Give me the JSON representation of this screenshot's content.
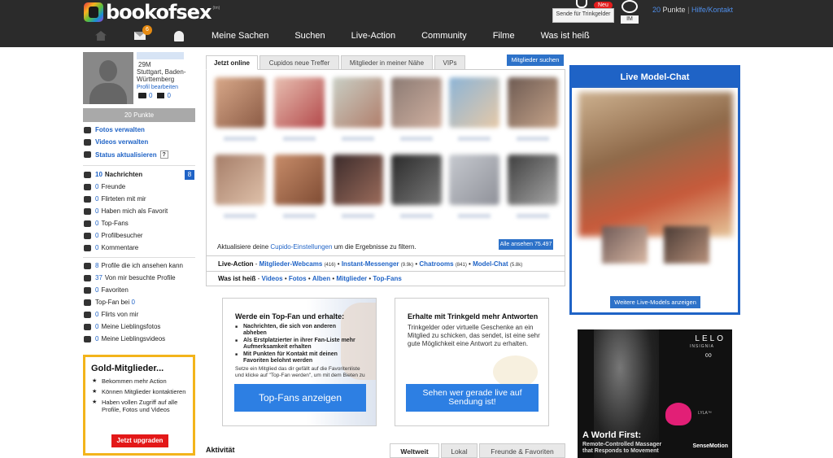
{
  "header": {
    "logo_text": "bookofsex",
    "logo_suffix": "(tm)",
    "tip_button": "Sende für Trinkgelder",
    "new_badge": "Neu",
    "im_label": "IM",
    "points_value": "20",
    "points_label": "Punkte",
    "separator": "|",
    "help_link": "Hilfe/Kontakt",
    "mail_count": "6",
    "nav": [
      "Meine Sachen",
      "Suchen",
      "Live-Action",
      "Community",
      "Filme",
      "Was ist heiß"
    ]
  },
  "profile": {
    "age_gender": "29M",
    "location": "Stuttgart, Baden-Württemberg",
    "edit_link": "Profil bearbeiten",
    "photo_count": "0",
    "video_count": "0",
    "points_bar": "20 Punkte"
  },
  "sidebar": {
    "manage": [
      "Fotos verwalten",
      "Videos verwalten",
      "Status aktualisieren"
    ],
    "help_mark": "?",
    "messages_count": "10",
    "messages_label": "Nachrichten",
    "messages_badge": "8",
    "stats": [
      {
        "num": "0",
        "label": "Freunde"
      },
      {
        "num": "0",
        "label": "Flirteten mit mir"
      },
      {
        "num": "0",
        "label": "Haben mich als Favorit"
      },
      {
        "num": "0",
        "label": "Top-Fans"
      },
      {
        "num": "0",
        "label": "Profilbesucher"
      },
      {
        "num": "0",
        "label": "Kommentare"
      }
    ],
    "stats2": [
      {
        "num": "8",
        "label": "Profile die ich ansehen kann"
      },
      {
        "num": "37",
        "label": "Von mir besuchte Profile"
      },
      {
        "num": "0",
        "label": "Favoriten"
      },
      {
        "num": "",
        "label": "Top-Fan bei",
        "num_after": "0"
      },
      {
        "num": "0",
        "label": "Flirts von mir"
      },
      {
        "num": "0",
        "label": "Meine Lieblingsfotos"
      },
      {
        "num": "0",
        "label": "Meine Lieblingsvideos"
      }
    ]
  },
  "gold": {
    "title": "Gold-Mitglieder...",
    "items": [
      "Bekommen mehr Action",
      "Können Mitglieder kontaktieren",
      "Haben vollen Zugriff auf alle Profile, Fotos und Videos"
    ],
    "button": "Jetzt upgraden"
  },
  "center": {
    "tabs": [
      "Jetzt online",
      "Cupidos neue Treffer",
      "Mitglieder in meiner Nähe",
      "VIPs"
    ],
    "search_button": "Mitglieder suchen",
    "cupido_pre": "Aktualisiere deine",
    "cupido_link": "Cupido-Einstellungen",
    "cupido_post": "um die Ergebnisse zu filtern.",
    "all_button": "Alle ansehen 75.497",
    "live_action_label": "Live-Action",
    "live_action_items": [
      {
        "label": "Mitglieder-Webcams",
        "count": "(416)"
      },
      {
        "label": "Instant-Messenger",
        "count": "(9.9k)"
      },
      {
        "label": "Chatrooms",
        "count": "(841)"
      },
      {
        "label": "Model-Chat",
        "count": "(5.8k)"
      }
    ],
    "hot_label": "Was ist heiß",
    "hot_items": [
      "Videos",
      "Fotos",
      "Alben",
      "Mitglieder",
      "Top-Fans"
    ]
  },
  "topfan": {
    "title": "Werde ein Top-Fan und erhalte:",
    "items": [
      "Nachrichten, die sich von anderen abheben",
      "Als Erstplatzierter in ihrer Fan-Liste mehr Aufmerksamkeit erhalten",
      "Mit Punkten für Kontakt mit deinen Favoriten belohnt werden"
    ],
    "description": "Setze ein Mitglied das dir gefällt auf die Favoritenliste und klicke auf \"Top-Fan werden\", um mit dem Bieten zu beginnen",
    "button": "Top-Fans anzeigen"
  },
  "tips": {
    "title": "Erhalte mit Trinkgeld mehr Antworten",
    "description": "Trinkgelder oder virtuelle Geschenke an ein Mitglied zu schicken, das sendet, ist eine sehr gute Möglichkeit eine Antwort zu erhalten.",
    "button": "Sehen wer gerade live auf Sendung ist!"
  },
  "activity": {
    "title": "Aktivität",
    "tabs": [
      "Weltweit",
      "Lokal",
      "Freunde & Favoriten"
    ]
  },
  "livechat": {
    "title": "Live Model-Chat",
    "more_button": "Weitere Live-Models anzeigen"
  },
  "ad": {
    "brand": "LELO",
    "line": "INSIGNIA",
    "symbol": "∞",
    "product": "LYLA™",
    "headline": "A World First:",
    "sub": "Remote-Controlled Massager that Responds to Movement",
    "tech": "SenseMotion"
  }
}
